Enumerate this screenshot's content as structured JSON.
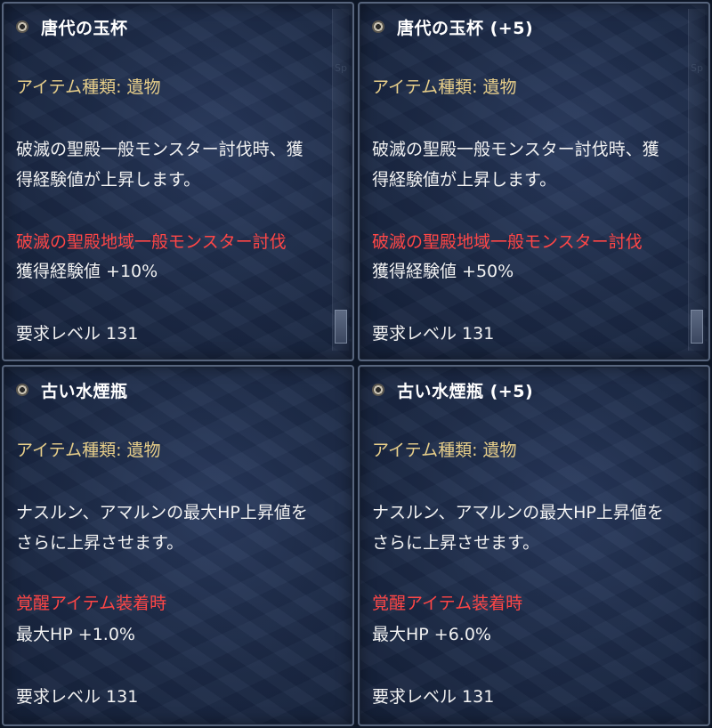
{
  "panels": [
    {
      "title": "唐代の玉杯",
      "type_line": "アイテム種類: 遺物",
      "desc1": "破滅の聖殿一般モンスター討伐時、獲",
      "desc2": "得経験値が上昇します。",
      "effect_header": "破滅の聖殿地域一般モンスター討伐",
      "effect_value": "獲得経験値 +10%",
      "req": "要求レベル 131"
    },
    {
      "title": "唐代の玉杯 (+5)",
      "type_line": "アイテム種類: 遺物",
      "desc1": "破滅の聖殿一般モンスター討伐時、獲",
      "desc2": "得経験値が上昇します。",
      "effect_header": "破滅の聖殿地域一般モンスター討伐",
      "effect_value": "獲得経験値 +50%",
      "req": "要求レベル 131"
    },
    {
      "title": "古い水煙瓶",
      "type_line": "アイテム種類: 遺物",
      "desc1": "ナスルン、アマルンの最大HP上昇値を",
      "desc2": "さらに上昇させます。",
      "effect_header": "覚醒アイテム装着時",
      "effect_value": "最大HP +1.0%",
      "req": "要求レベル 131"
    },
    {
      "title": "古い水煙瓶 (+5)",
      "type_line": "アイテム種類: 遺物",
      "desc1": "ナスルン、アマルンの最大HP上昇値を",
      "desc2": "さらに上昇させます。",
      "effect_header": "覚醒アイテム装着時",
      "effect_value": "最大HP +6.0%",
      "req": "要求レベル 131"
    }
  ],
  "colors": {
    "title": "#ffffff",
    "type_line": "#e8cf8a",
    "effect_header": "#ff4646",
    "body": "#f2f2f2"
  },
  "icons": [
    "gem-icon"
  ]
}
